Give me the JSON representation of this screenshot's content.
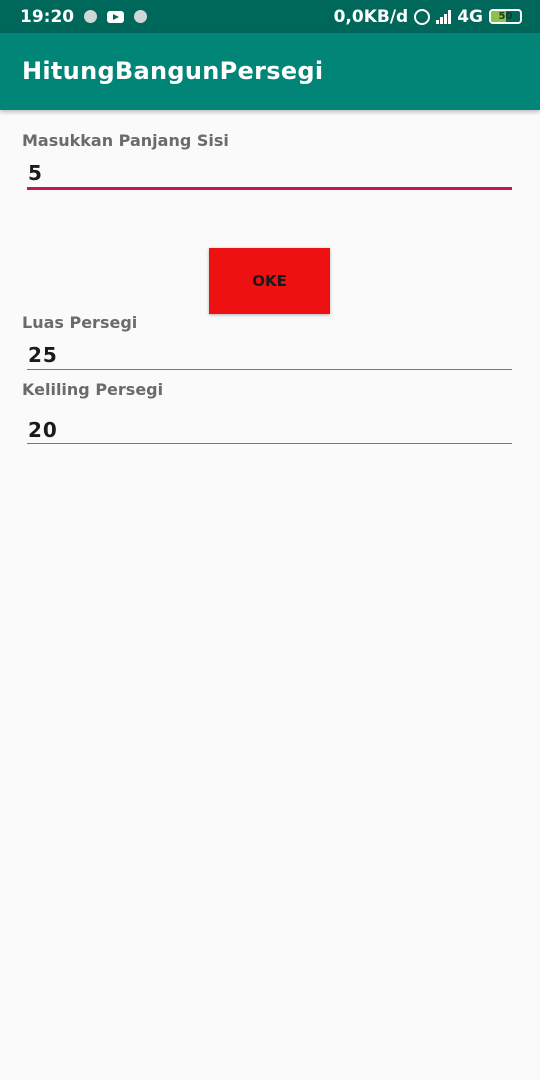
{
  "status_bar": {
    "time": "19:20",
    "network_speed": "0,0KB/d",
    "network_type": "4G",
    "battery_percent": "50",
    "icons": [
      "circle-notification-icon",
      "youtube-icon",
      "circle-notification-icon",
      "alarm-icon",
      "signal-icon",
      "battery-icon"
    ]
  },
  "app_bar": {
    "title": "HitungBangunPersegi",
    "color": "#008577"
  },
  "form": {
    "side_label": "Masukkan Panjang Sisi",
    "side_value": "5",
    "accent_color": "#c2185b",
    "button_label": "OKE",
    "button_color": "#ee1111",
    "area_label": "Luas Persegi",
    "area_value": "25",
    "perimeter_label": "Keliling Persegi",
    "perimeter_value": "20"
  }
}
